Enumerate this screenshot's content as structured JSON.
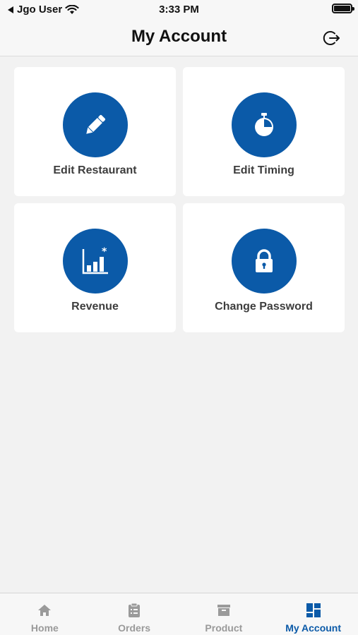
{
  "status_bar": {
    "carrier": "Jgo User",
    "time": "3:33 PM"
  },
  "header": {
    "title": "My Account"
  },
  "tiles": [
    {
      "label": "Edit Restaurant",
      "icon": "pencil-icon"
    },
    {
      "label": "Edit Timing",
      "icon": "stopwatch-icon"
    },
    {
      "label": "Revenue",
      "icon": "chart-icon"
    },
    {
      "label": "Change Password",
      "icon": "lock-icon"
    }
  ],
  "tab_bar": {
    "items": [
      {
        "label": "Home",
        "icon": "home-icon",
        "active": false
      },
      {
        "label": "Orders",
        "icon": "clipboard-icon",
        "active": false
      },
      {
        "label": "Product",
        "icon": "box-icon",
        "active": false
      },
      {
        "label": "My Account",
        "icon": "dashboard-icon",
        "active": true
      }
    ]
  },
  "colors": {
    "accent": "#0b5aa8",
    "inactive_tab": "#9a9a9a",
    "background": "#f2f2f2"
  }
}
